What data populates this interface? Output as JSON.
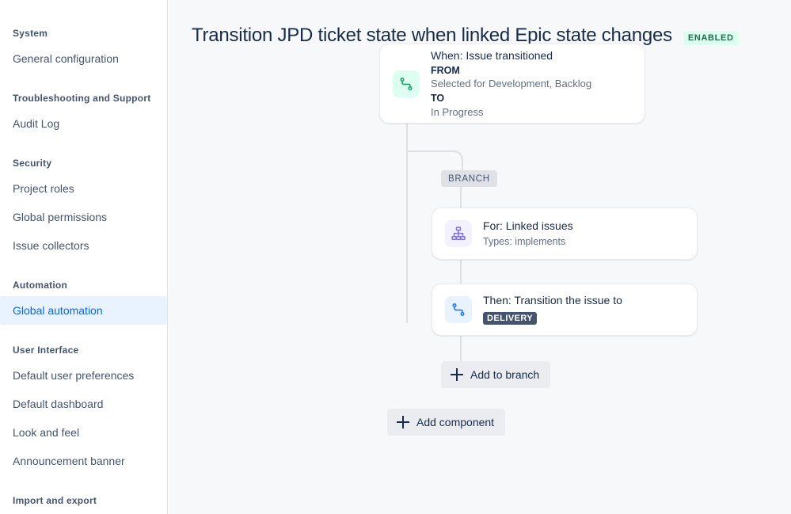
{
  "sidebar": {
    "groups": [
      {
        "title": "System",
        "items": [
          {
            "label": "General configuration",
            "selected": false
          }
        ]
      },
      {
        "title": "Troubleshooting and Support",
        "items": [
          {
            "label": "Audit Log",
            "selected": false
          }
        ]
      },
      {
        "title": "Security",
        "items": [
          {
            "label": "Project roles",
            "selected": false
          },
          {
            "label": "Global permissions",
            "selected": false
          },
          {
            "label": "Issue collectors",
            "selected": false
          }
        ]
      },
      {
        "title": "Automation",
        "items": [
          {
            "label": "Global automation",
            "selected": true
          }
        ]
      },
      {
        "title": "User Interface",
        "items": [
          {
            "label": "Default user preferences",
            "selected": false
          },
          {
            "label": "Default dashboard",
            "selected": false
          },
          {
            "label": "Look and feel",
            "selected": false
          },
          {
            "label": "Announcement banner",
            "selected": false
          }
        ]
      },
      {
        "title": "Import and export",
        "items": []
      }
    ]
  },
  "header": {
    "title": "Transition JPD ticket state when linked Epic state changes",
    "status_badge": "ENABLED"
  },
  "flow": {
    "branch_label": "BRANCH",
    "trigger": {
      "icon": "transition-icon",
      "title": "When: Issue transitioned",
      "from_key": "FROM",
      "from_value": "Selected for Development, Backlog",
      "to_key": "TO",
      "to_value": "In Progress"
    },
    "branch_condition": {
      "icon": "linked-issues-icon",
      "title": "For: Linked issues",
      "subtitle": "Types: implements"
    },
    "branch_action": {
      "icon": "transition-icon",
      "title": "Then: Transition the issue to",
      "lozenge": "DELIVERY"
    },
    "add_to_branch_label": "Add to branch",
    "add_component_label": "Add component"
  },
  "colors": {
    "accent_blue": "#0C66E4",
    "enabled_green": "#216E4E",
    "lozenge_dark": "#44546F",
    "canvas_bg": "#F7F8F9",
    "connector": "#DCDFE4"
  }
}
